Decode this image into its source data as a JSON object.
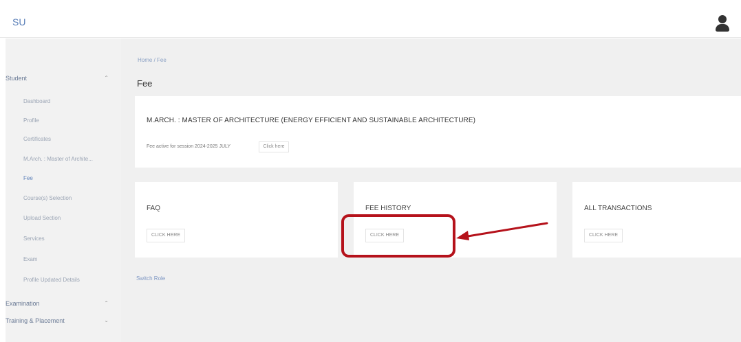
{
  "header": {
    "brand": "SU"
  },
  "sidebar": {
    "sections": [
      {
        "label": "Student"
      },
      {
        "label": "Examination"
      },
      {
        "label": "Training & Placement"
      }
    ],
    "items": [
      {
        "label": "Dashboard"
      },
      {
        "label": "Profile"
      },
      {
        "label": "Certificates"
      },
      {
        "label": "M.Arch. : Master of Archite..."
      },
      {
        "label": "Fee"
      },
      {
        "label": "Course(s) Selection"
      },
      {
        "label": "Upload Section"
      },
      {
        "label": "Services"
      },
      {
        "label": "Exam"
      },
      {
        "label": "Profile Updated Details"
      }
    ]
  },
  "breadcrumb": "Home / Fee",
  "page_title": "Fee",
  "program": {
    "title": "M.ARCH. : MASTER OF ARCHITECTURE (ENERGY EFFICIENT AND SUSTAINABLE ARCHITECTURE)",
    "session_text": "Fee active for session 2024-2025 JULY",
    "click_label": "Click here"
  },
  "cards": [
    {
      "title": "FAQ",
      "button": "CLICK HERE"
    },
    {
      "title": "FEE HISTORY",
      "button": "CLICK HERE"
    },
    {
      "title": "ALL TRANSACTIONS",
      "button": "CLICK HERE"
    }
  ],
  "footer_link": "Switch Role",
  "colors": {
    "annotation": "#b5121b",
    "link": "#5a7fb8"
  }
}
